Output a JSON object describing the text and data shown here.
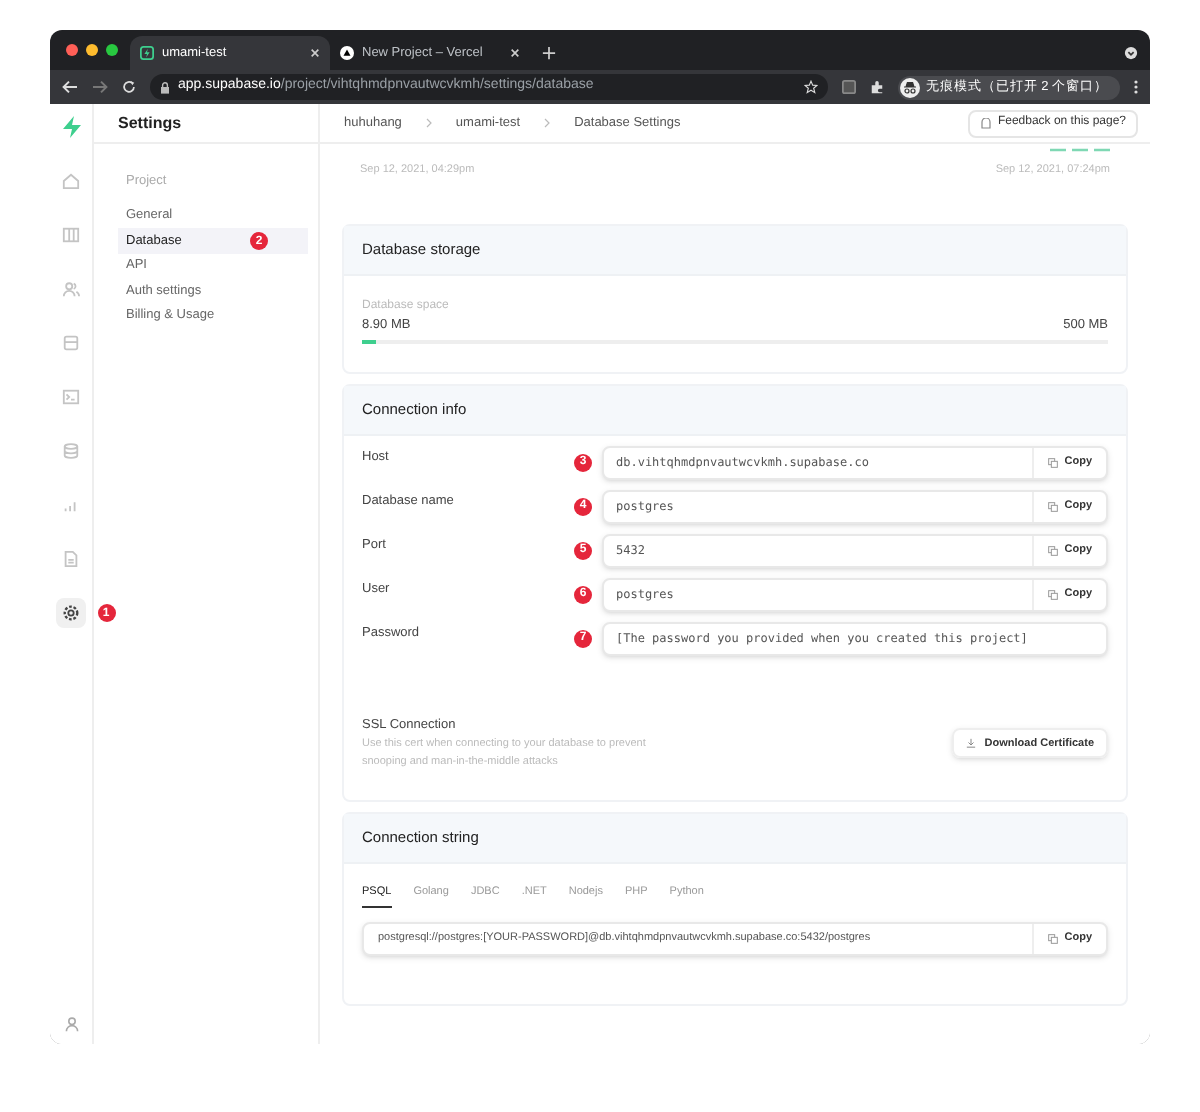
{
  "browser": {
    "tabs": [
      {
        "title": "umami-test",
        "selected": true,
        "kind": "supabase"
      },
      {
        "title": "New Project – Vercel",
        "selected": false,
        "kind": "vercel"
      }
    ],
    "url": {
      "host": "app.supabase.io",
      "path": "/project/vihtqhmdpnvautwcvkmh/settings/database"
    },
    "profile": "无痕模式（已打开 2 个窗口）"
  },
  "rail": {
    "items": [
      {
        "kind": "home",
        "selected": false
      },
      {
        "kind": "table",
        "selected": false
      },
      {
        "kind": "users",
        "selected": false
      },
      {
        "kind": "archive",
        "selected": false
      },
      {
        "kind": "terminal",
        "selected": false
      },
      {
        "kind": "database",
        "selected": false
      },
      {
        "kind": "chart",
        "selected": false
      },
      {
        "kind": "document",
        "selected": false
      },
      {
        "kind": "settings",
        "selected": true,
        "badge": "1"
      }
    ]
  },
  "sidebar": {
    "title": "Settings",
    "section": "Project",
    "items": [
      {
        "label": "General",
        "selected": false
      },
      {
        "label": "Database",
        "selected": true,
        "badge": "2"
      },
      {
        "label": "API",
        "selected": false
      },
      {
        "label": "Auth settings",
        "selected": false
      },
      {
        "label": "Billing & Usage",
        "selected": false
      }
    ]
  },
  "breadcrumb": [
    "huhuhang",
    "umami-test",
    "Database Settings"
  ],
  "feedback": "Feedback on this page?",
  "dates": [
    "Sep 12, 2021, 04:29pm",
    "Sep 12, 2021, 07:24pm"
  ],
  "storage": {
    "title": "Database storage",
    "label": "Database space",
    "used": "8.90 MB",
    "total": "500 MB",
    "level": 0.02
  },
  "connection_info": {
    "title": "Connection info",
    "fields": [
      {
        "label": "Host",
        "value": "db.vihtqhmdpnvautwcvkmh.supabase.co",
        "badge": "3",
        "copy": "Copy"
      },
      {
        "label": "Database name",
        "value": "postgres",
        "badge": "4",
        "copy": "Copy"
      },
      {
        "label": "Port",
        "value": "5432",
        "badge": "5",
        "copy": "Copy"
      },
      {
        "label": "User",
        "value": "postgres",
        "badge": "6",
        "copy": "Copy"
      },
      {
        "label": "Password",
        "value": "[The password you provided when you created this project]",
        "badge": "7"
      }
    ]
  },
  "ssl": {
    "title": "SSL Connection",
    "description": "Use this cert when connecting to your database to prevent snooping and man-in-the-middle attacks",
    "button": "Download Certificate"
  },
  "connection_string": {
    "title": "Connection string",
    "tabs": [
      {
        "label": "PSQL",
        "selected": true
      },
      {
        "label": "Golang",
        "selected": false
      },
      {
        "label": "JDBC",
        "selected": false
      },
      {
        "label": ".NET",
        "selected": false
      },
      {
        "label": "Nodejs",
        "selected": false
      },
      {
        "label": "PHP",
        "selected": false
      },
      {
        "label": "Python",
        "selected": false
      }
    ],
    "value": "postgresql://postgres:[YOUR-PASSWORD]@db.vihtqhmdpnvautwcvkmh.supabase.co:5432/postgres",
    "copy": "Copy"
  }
}
